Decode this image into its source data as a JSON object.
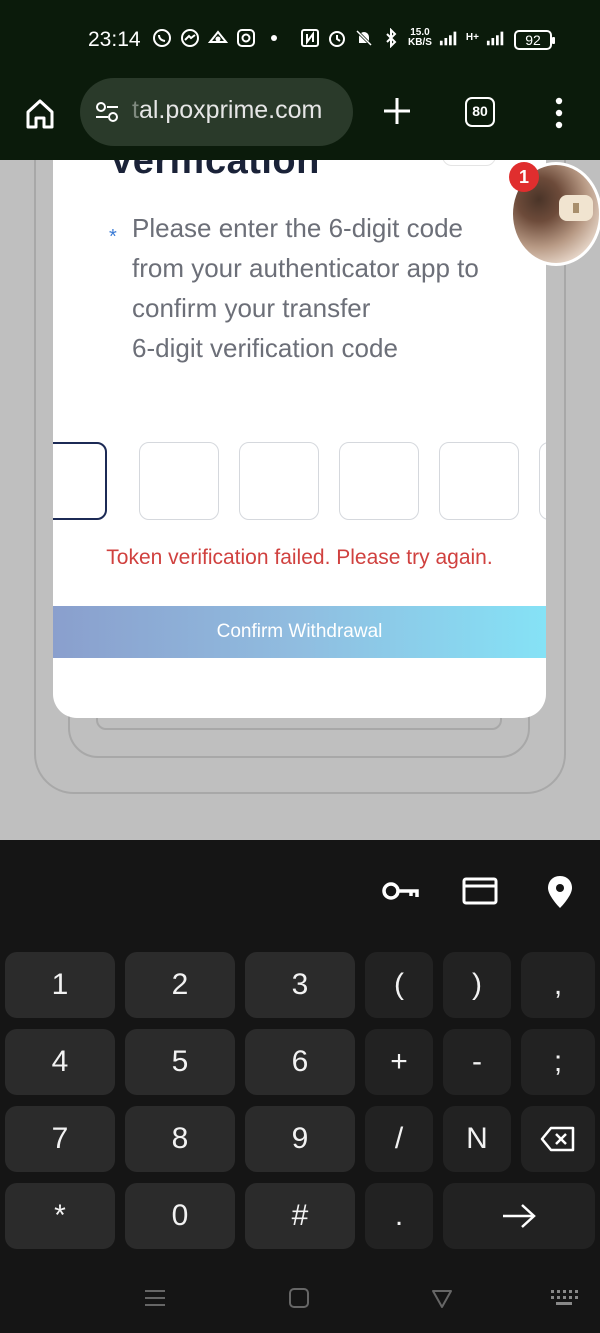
{
  "status_bar": {
    "time": "23:14",
    "net_speed_value": "15.0",
    "net_speed_unit": "KB/S",
    "signal_label": "H+",
    "battery": "92",
    "icons": [
      "whatsapp-icon",
      "messenger-icon",
      "eye-icon",
      "instagram-icon",
      "dot-icon",
      "nfc-icon",
      "alarm-icon",
      "mute-icon",
      "bluetooth-icon",
      "signal-icon",
      "signal-icon"
    ]
  },
  "browser": {
    "url_faded": "t",
    "url": "al.poxprime.com",
    "tab_count": "80"
  },
  "modal": {
    "title": "Verification",
    "required_mark": "*",
    "description": "Please enter the 6-digit code from your authenticator app to confirm your transfer",
    "code_label": "6-digit verification code",
    "error": "Token verification failed. Please try again.",
    "confirm_label": "Confirm Withdrawal"
  },
  "chat_head": {
    "badge": "1"
  },
  "keyboard": {
    "rows": [
      [
        "1",
        "2",
        "3",
        "(",
        ")",
        ","
      ],
      [
        "4",
        "5",
        "6",
        "+",
        "-",
        ";"
      ],
      [
        "7",
        "8",
        "9",
        "/",
        "N",
        "⌫"
      ],
      [
        "*",
        "0",
        "#",
        ".",
        "→"
      ]
    ],
    "toolbar_icons": [
      "key-icon",
      "card-icon",
      "location-pin-icon"
    ]
  },
  "nav_bar": {
    "icons": [
      "menu-icon",
      "home-square-icon",
      "back-triangle-icon",
      "keyboard-icon"
    ]
  },
  "colors": {
    "error": "#d0413f",
    "title": "#1a2238",
    "button_gradient_start": "#8a9fcd",
    "button_gradient_end": "#85e2f6"
  }
}
